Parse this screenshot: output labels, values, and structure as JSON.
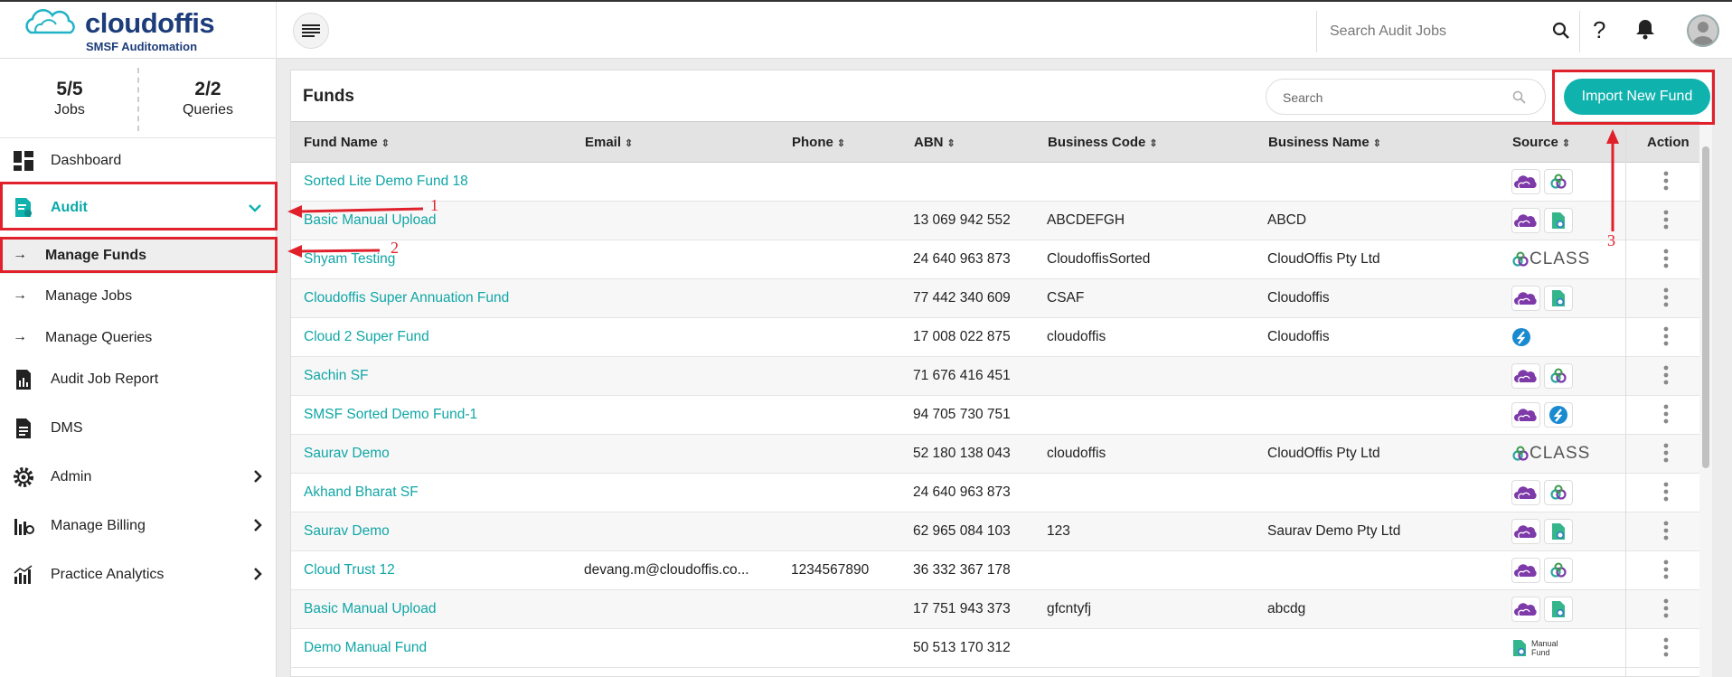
{
  "app": {
    "logo_text": "cloudoffis",
    "logo_subtitle": "SMSF Auditomation"
  },
  "header": {
    "search_placeholder": "Search Audit Jobs",
    "help_label": "?"
  },
  "stats": [
    {
      "value": "5/5",
      "label": "Jobs"
    },
    {
      "value": "2/2",
      "label": "Queries"
    }
  ],
  "sidebar": {
    "items": [
      {
        "label": "Dashboard"
      },
      {
        "label": "Audit"
      },
      {
        "label": "Manage Funds"
      },
      {
        "label": "Manage Jobs"
      },
      {
        "label": "Manage Queries"
      },
      {
        "label": "Audit Job Report"
      },
      {
        "label": "DMS"
      },
      {
        "label": "Admin"
      },
      {
        "label": "Manage Billing"
      },
      {
        "label": "Practice Analytics"
      }
    ]
  },
  "panel": {
    "title": "Funds",
    "search_placeholder": "Search",
    "import_label": "Import New Fund"
  },
  "table": {
    "columns": [
      "Fund Name",
      "Email",
      "Phone",
      "ABN",
      "Business Code",
      "Business Name",
      "Source",
      "Action"
    ],
    "rows": [
      {
        "fund": "Sorted Lite Demo Fund 18",
        "email": "",
        "phone": "",
        "abn": "",
        "code": "",
        "bname": "",
        "source": "cloud+link"
      },
      {
        "fund": "Basic Manual Upload",
        "email": "",
        "phone": "",
        "abn": "13 069 942 552",
        "code": "ABCDEFGH",
        "bname": "ABCD",
        "source": "cloud+doc"
      },
      {
        "fund": "Shyam Testing",
        "email": "",
        "phone": "",
        "abn": "24 640 963 873",
        "code": "CloudoffisSorted",
        "bname": "CloudOffis Pty Ltd",
        "source": "class"
      },
      {
        "fund": "Cloudoffis Super Annuation Fund",
        "email": "",
        "phone": "",
        "abn": "77 442 340 609",
        "code": "CSAF",
        "bname": "Cloudoffis",
        "source": "cloud+doc"
      },
      {
        "fund": "Cloud 2 Super Fund",
        "email": "",
        "phone": "",
        "abn": "17 008 022 875",
        "code": "cloudoffis",
        "bname": "Cloudoffis",
        "source": "sorted"
      },
      {
        "fund": "Sachin SF",
        "email": "",
        "phone": "",
        "abn": "71 676 416 451",
        "code": "",
        "bname": "",
        "source": "cloud+link"
      },
      {
        "fund": "SMSF Sorted Demo Fund-1",
        "email": "",
        "phone": "",
        "abn": "94 705 730 751",
        "code": "",
        "bname": "",
        "source": "cloud+sorted"
      },
      {
        "fund": "Saurav Demo",
        "email": "",
        "phone": "",
        "abn": "52 180 138 043",
        "code": "cloudoffis",
        "bname": "CloudOffis Pty Ltd",
        "source": "class"
      },
      {
        "fund": "Akhand Bharat SF",
        "email": "",
        "phone": "",
        "abn": "24 640 963 873",
        "code": "",
        "bname": "",
        "source": "cloud+link"
      },
      {
        "fund": "Saurav Demo",
        "email": "",
        "phone": "",
        "abn": "62 965 084 103",
        "code": "123",
        "bname": "Saurav Demo Pty Ltd",
        "source": "cloud+doc"
      },
      {
        "fund": "Cloud Trust 12",
        "email": "devang.m@cloudoffis.co...",
        "phone": "1234567890",
        "abn": "36 332 367 178",
        "code": "",
        "bname": "",
        "source": "cloud+link"
      },
      {
        "fund": "Basic Manual Upload",
        "email": "",
        "phone": "",
        "abn": "17 751 943 373",
        "code": "gfcntyfj",
        "bname": "abcdg",
        "source": "cloud+doc"
      },
      {
        "fund": "Demo Manual Fund",
        "email": "",
        "phone": "",
        "abn": "50 513 170 312",
        "code": "",
        "bname": "",
        "source": "manual"
      }
    ]
  },
  "source_labels": {
    "class_text": "CLASS",
    "manual_line1": "Manual",
    "manual_line2": "Fund"
  },
  "annotations": [
    "1",
    "2",
    "3"
  ],
  "colors": {
    "accent": "#10b2ae",
    "annotation": "#e0212b",
    "brand": "#1d3d7a"
  }
}
